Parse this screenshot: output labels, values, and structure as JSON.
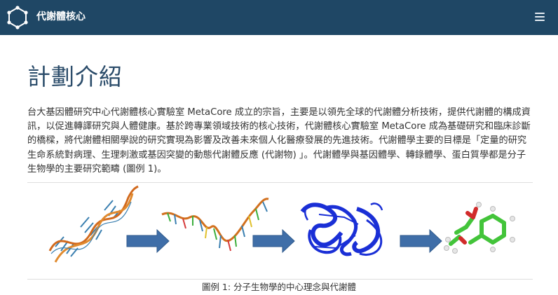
{
  "header": {
    "brand_title": "代謝體核心",
    "logo_icon": "hexagon-molecule-icon",
    "menu_icon": "hamburger-menu-icon",
    "background": "#1f4765"
  },
  "main": {
    "page_title": "計劃介紹",
    "intro_paragraph": "台大基因體研究中心代謝體核心實驗室 MetaCore 成立的宗旨，主要是以領先全球的代謝體分析技術，提供代謝體的構成資訊，以促進轉譯研究與人體健康。基於跨專業領域技術的核心技術，代謝體核心實驗室 MetaCore 成為基礎研究和臨床診斷的橋樑，將代謝體相關學說的研究實現為影響及改善未來個人化醫療發展的先進技術。代謝體學主要的目標是「定量的研究生命系統對病理、生理刺激或基因突變的動態代謝體反應 (代謝物) 」。代謝體學與基因體學、轉錄體學、蛋白質學都是分子生物學的主要研究範疇 (圖例 1)。",
    "figure": {
      "caption": "圖例 1: 分子生物學的中心理念與代謝體",
      "stages": [
        "dna-double-helix-image",
        "rna-strand-image",
        "protein-structure-image",
        "metabolite-molecule-image"
      ],
      "arrow_icon": "right-arrow-icon",
      "arrow_color": "#3f6ea8",
      "protein_color": "#1a2fd6",
      "molecule_color": "#43c43a"
    }
  }
}
